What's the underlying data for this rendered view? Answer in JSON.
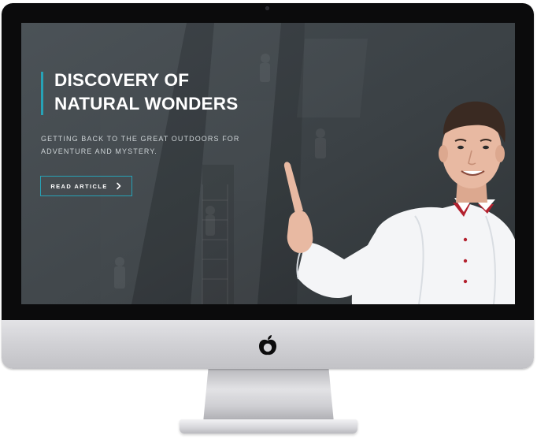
{
  "hero": {
    "title_line1": "DISCOVERY OF",
    "title_line2": "NATURAL WONDERS",
    "subtitle_line1": "GETTING BACK TO THE GREAT OUTDOORS FOR",
    "subtitle_line2": "ADVENTURE AND MYSTERY.",
    "button_label": "READ ARTICLE",
    "button_icon": "chevron-right-icon"
  },
  "colors": {
    "accent": "#27a2b6",
    "screen_background": "#3d4347",
    "bezel": "#0b0b0c",
    "chin": "#d2d2d6"
  },
  "device": {
    "logo_icon": "apple-shaped-logo-icon"
  }
}
